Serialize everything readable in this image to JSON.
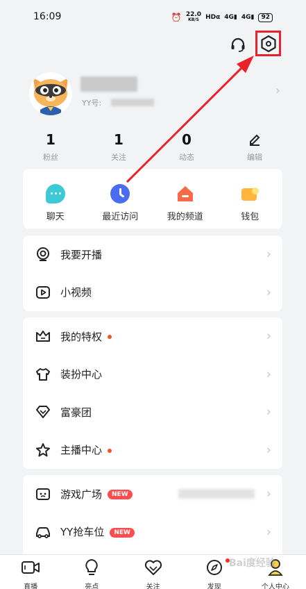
{
  "status": {
    "time": "16:09",
    "net_speed": "22.0",
    "net_unit": "KB/S",
    "hd": "HDα",
    "sig1": "4G",
    "sig2": "4G",
    "battery": "92"
  },
  "header": {
    "support_icon": "headset-icon",
    "settings_icon": "settings-hexagon-icon"
  },
  "profile": {
    "yy_label": "YY号:"
  },
  "stats": [
    {
      "value": "1",
      "label": "粉丝"
    },
    {
      "value": "1",
      "label": "关注"
    },
    {
      "value": "0",
      "label": "动态"
    },
    {
      "label": "编辑"
    }
  ],
  "quick": [
    {
      "label": "聊天",
      "color": "#3ec9d6"
    },
    {
      "label": "最近访问",
      "color": "#4a6cf0"
    },
    {
      "label": "我的频道",
      "color": "#f56b4a"
    },
    {
      "label": "钱包",
      "color": "#ffb43c"
    }
  ],
  "group1": [
    {
      "label": "我要开播"
    },
    {
      "label": "小视频"
    }
  ],
  "group2": [
    {
      "label": "我的特权"
    },
    {
      "label": "装扮中心"
    },
    {
      "label": "富豪团"
    },
    {
      "label": "主播中心"
    }
  ],
  "group3": [
    {
      "label": "游戏广场",
      "badge": "NEW"
    },
    {
      "label": "YY抢车位",
      "badge": "NEW"
    }
  ],
  "nav": [
    {
      "label": "直播"
    },
    {
      "label": "亮点"
    },
    {
      "label": "关注"
    },
    {
      "label": "发现"
    },
    {
      "label": "个人中心"
    }
  ],
  "watermark": "Bai度经验",
  "colors": {
    "accent_red": "#e8222b",
    "dot_orange": "#f5541f",
    "badge_red": "#ff4d4f"
  }
}
